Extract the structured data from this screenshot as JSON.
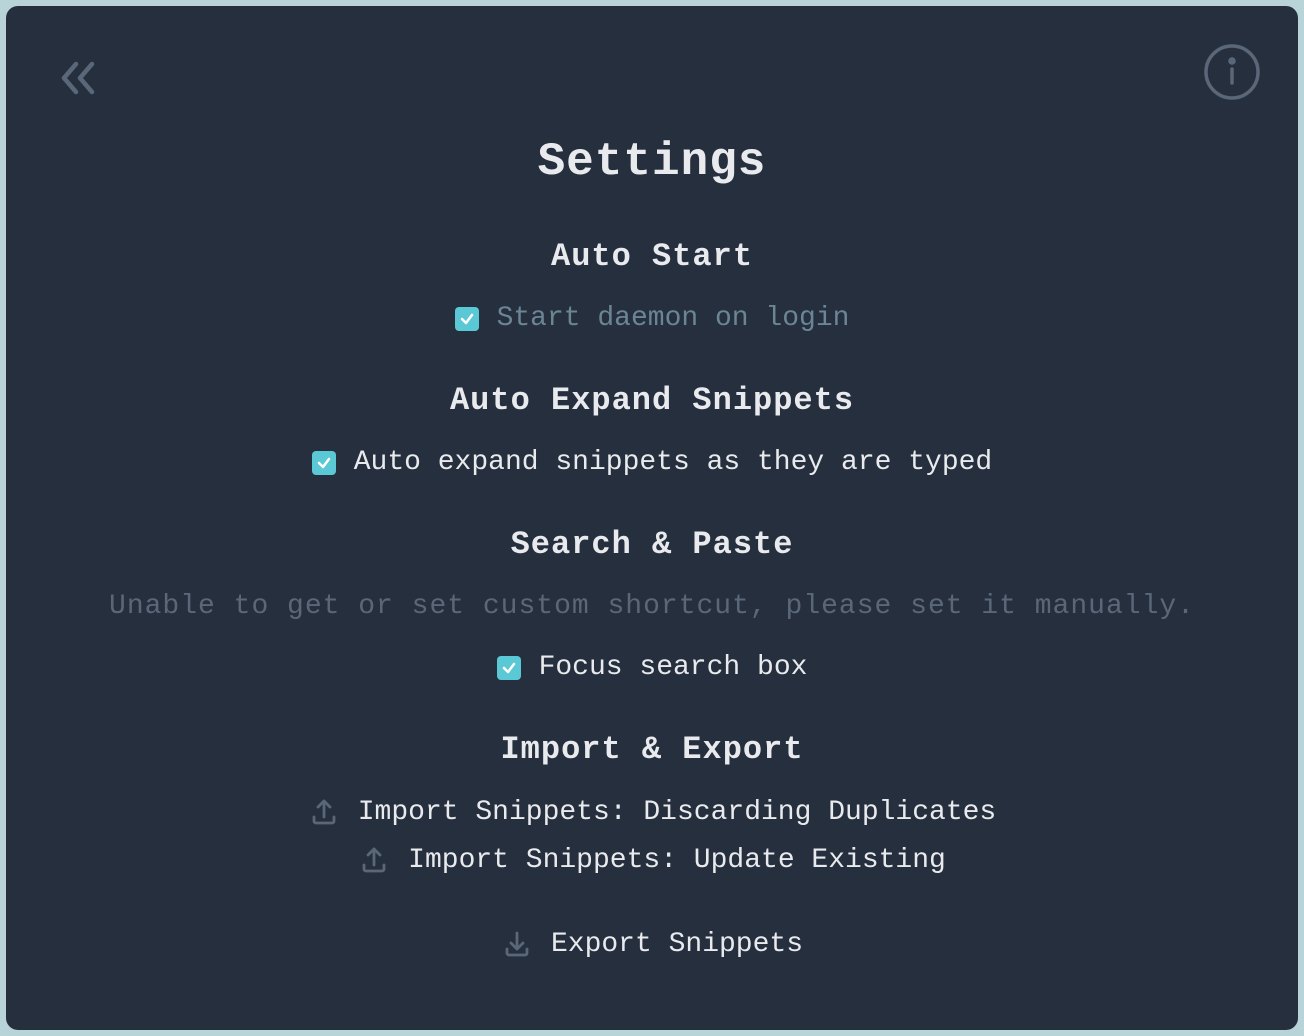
{
  "title": "Settings",
  "sections": {
    "autoStart": {
      "heading": "Auto Start",
      "checkbox": {
        "label": "Start daemon on login",
        "checked": true
      }
    },
    "autoExpand": {
      "heading": "Auto Expand Snippets",
      "checkbox": {
        "label": "Auto expand snippets as they are typed",
        "checked": true
      }
    },
    "searchPaste": {
      "heading": "Search & Paste",
      "warning": "Unable to get or set custom shortcut, please set it manually.",
      "checkbox": {
        "label": "Focus search box",
        "checked": true
      }
    },
    "importExport": {
      "heading": "Import & Export",
      "actions": {
        "importDiscard": "Import Snippets: Discarding Duplicates",
        "importUpdate": "Import Snippets: Update Existing",
        "export": "Export Snippets"
      }
    }
  }
}
